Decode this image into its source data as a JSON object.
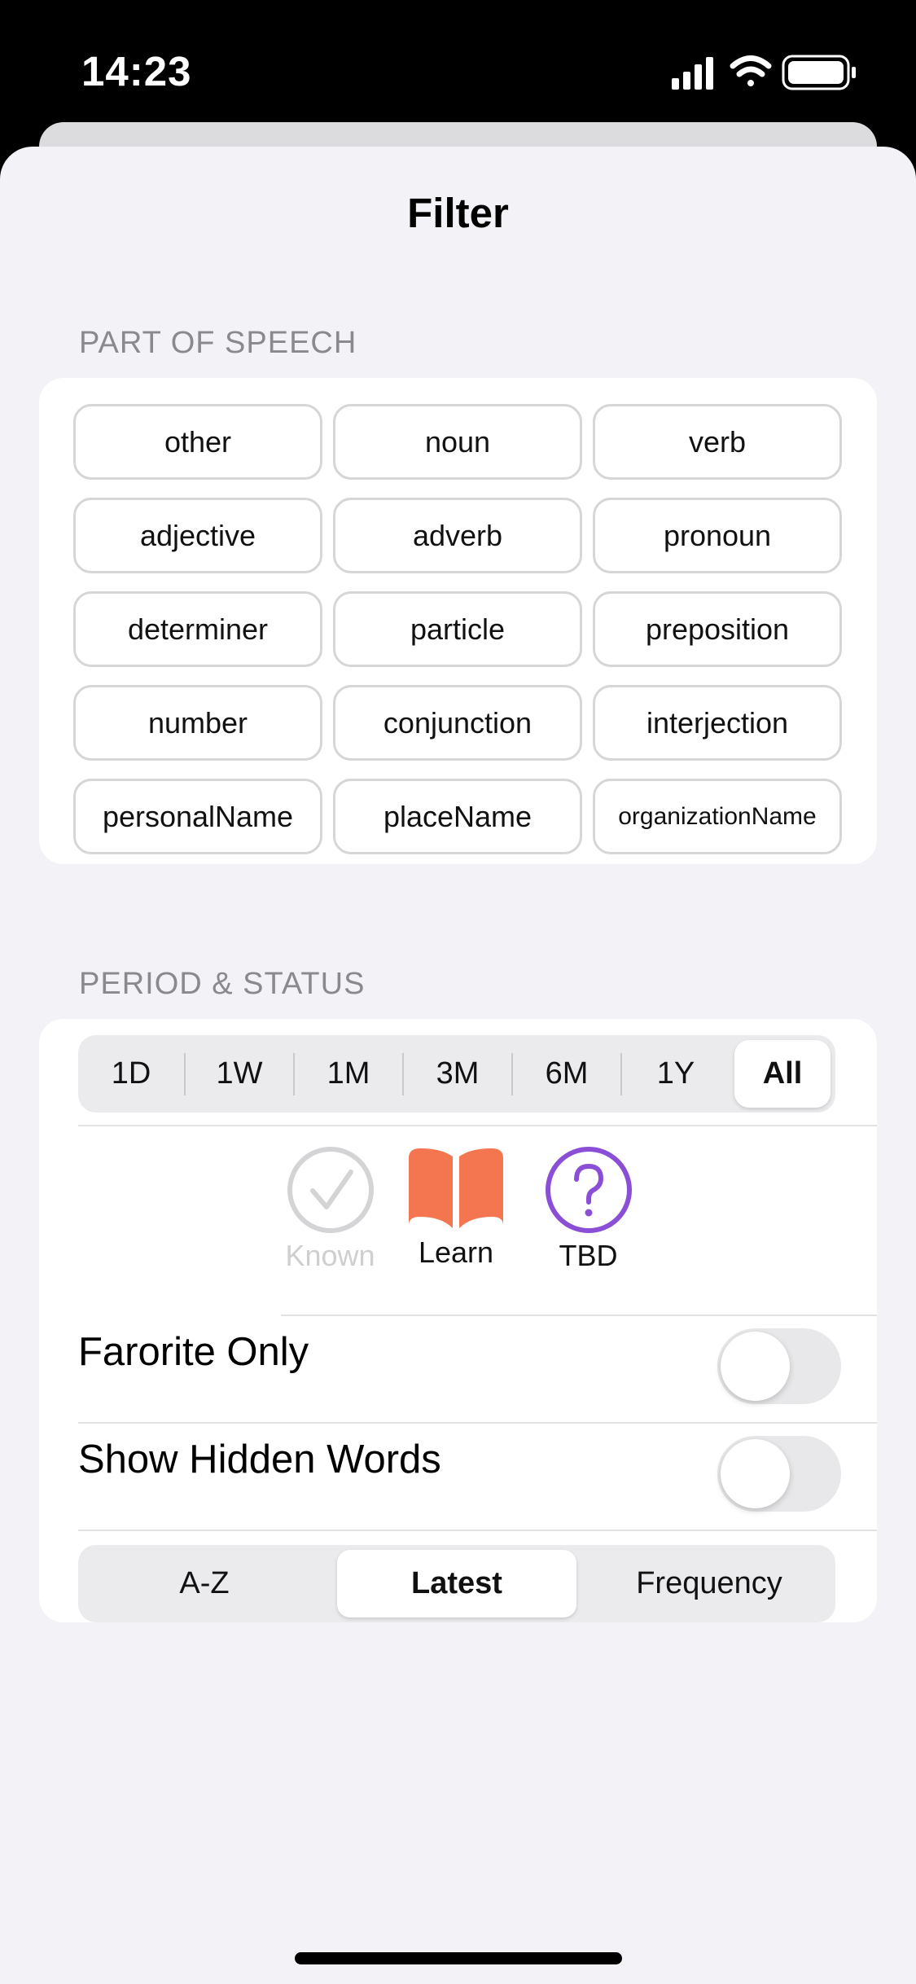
{
  "status_bar": {
    "time": "14:23",
    "icons": [
      "cellular-signal-icon",
      "wifi-icon",
      "battery-icon"
    ]
  },
  "sheet": {
    "title": "Filter"
  },
  "part_of_speech": {
    "header": "PART OF SPEECH",
    "items": [
      "other",
      "noun",
      "verb",
      "adjective",
      "adverb",
      "pronoun",
      "determiner",
      "particle",
      "preposition",
      "number",
      "conjunction",
      "interjection",
      "personalName",
      "placeName",
      "organizationName"
    ]
  },
  "period_status": {
    "header": "PERIOD & STATUS",
    "periods": [
      "1D",
      "1W",
      "1M",
      "3M",
      "6M",
      "1Y",
      "All"
    ],
    "selected_period": "All",
    "statuses": [
      {
        "label": "Known",
        "icon": "checkmark-circle-icon",
        "enabled": false
      },
      {
        "label": "Learn",
        "icon": "book-icon",
        "color": "#f47651",
        "enabled": true
      },
      {
        "label": "TBD",
        "icon": "question-circle-icon",
        "color": "#8a4fd6",
        "enabled": true
      }
    ],
    "favorite_only": {
      "label": "Farorite Only",
      "on": false
    },
    "show_hidden": {
      "label": "Show Hidden Words",
      "on": false
    },
    "sort": {
      "options": [
        "A-Z",
        "Latest",
        "Frequency"
      ],
      "selected": "Latest"
    }
  }
}
